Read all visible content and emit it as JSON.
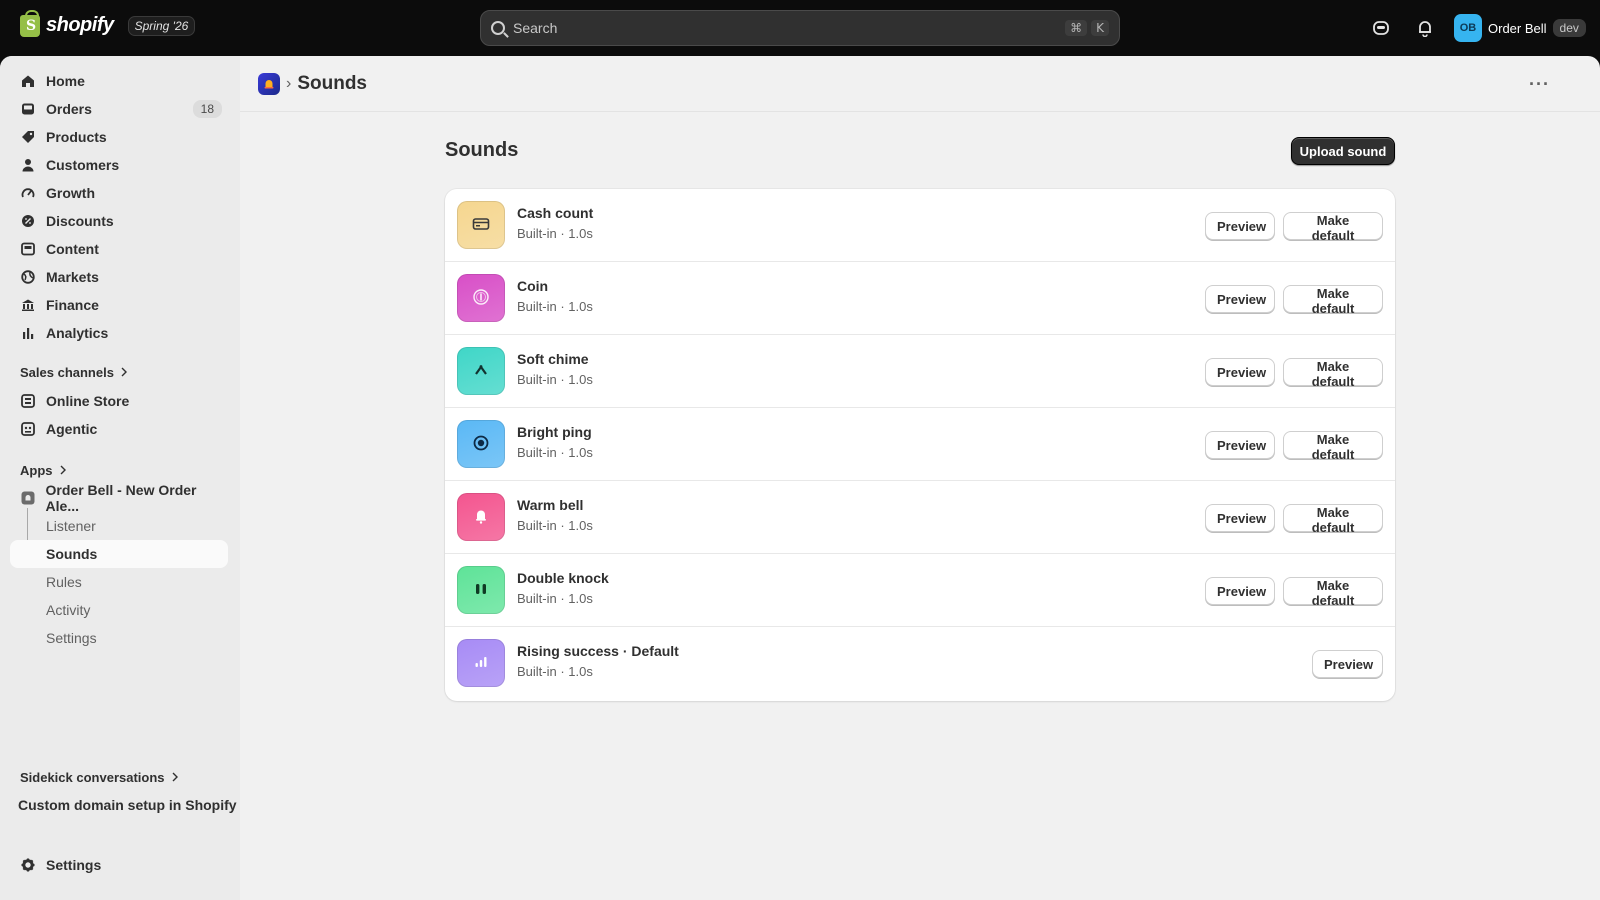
{
  "topbar": {
    "brand": "shopify",
    "brand_mark": "S",
    "edition": "Spring '26",
    "search_placeholder": "Search",
    "shortcut_mod": "⌘",
    "shortcut_key": "K",
    "avatar_initials": "OB",
    "store_name": "Order Bell",
    "env_badge": "dev"
  },
  "sidebar": {
    "items": [
      {
        "label": "Home",
        "icon": "home-icon"
      },
      {
        "label": "Orders",
        "icon": "inbox-icon",
        "count": "18"
      },
      {
        "label": "Products",
        "icon": "tag-icon"
      },
      {
        "label": "Customers",
        "icon": "person-icon"
      },
      {
        "label": "Growth",
        "icon": "gauge-icon"
      },
      {
        "label": "Discounts",
        "icon": "discount-icon"
      },
      {
        "label": "Content",
        "icon": "content-icon"
      },
      {
        "label": "Markets",
        "icon": "globe-icon"
      },
      {
        "label": "Finance",
        "icon": "bank-icon"
      },
      {
        "label": "Analytics",
        "icon": "bar-chart-icon"
      }
    ],
    "sales_channels_label": "Sales channels",
    "channels": [
      {
        "label": "Online Store",
        "icon": "store-icon"
      },
      {
        "label": "Agentic",
        "icon": "robot-icon"
      }
    ],
    "apps_label": "Apps",
    "app_name": "Order Bell - New Order Ale...",
    "app_subitems": [
      "Listener",
      "Sounds",
      "Rules",
      "Activity",
      "Settings"
    ],
    "sidekick_label": "Sidekick conversations",
    "sidekick_item": "Custom domain setup in Shopify",
    "settings_label": "Settings"
  },
  "page": {
    "breadcrumb_title": "Sounds",
    "more_label": "···",
    "title": "Sounds",
    "upload_label": "Upload sound",
    "preview_label": "Preview",
    "make_default_label": "Make default",
    "sounds": [
      {
        "name": "Cash count",
        "meta": "Built-in · 1.0s",
        "color": "#f5d68f",
        "icon": "wallet-icon"
      },
      {
        "name": "Coin",
        "meta": "Built-in · 1.0s",
        "color": "#d84fc7",
        "icon": "coin-icon"
      },
      {
        "name": "Soft chime",
        "meta": "Built-in · 1.0s",
        "color": "#3fd6c7",
        "icon": "chime-icon"
      },
      {
        "name": "Bright ping",
        "meta": "Built-in · 1.0s",
        "color": "#5ab8f5",
        "icon": "target-icon"
      },
      {
        "name": "Warm bell",
        "meta": "Built-in · 1.0s",
        "color": "#f3558f",
        "icon": "bell-icon"
      },
      {
        "name": "Double knock",
        "meta": "Built-in · 1.0s",
        "color": "#5ee398",
        "icon": "pause-icon"
      },
      {
        "name": "Rising success · Default",
        "meta": "Built-in · 1.0s",
        "color": "#a78bf5",
        "icon": "bars-icon"
      }
    ]
  }
}
